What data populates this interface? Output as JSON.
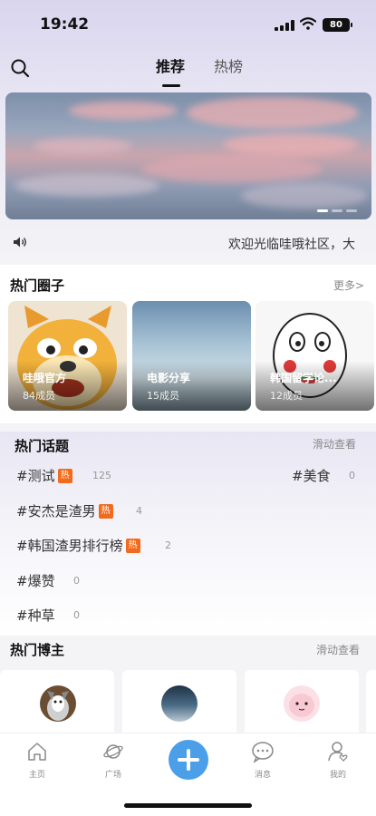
{
  "status": {
    "time": "19:42",
    "battery": "80"
  },
  "header": {
    "tabs": [
      {
        "label": "推荐",
        "active": true
      },
      {
        "label": "热榜",
        "active": false
      }
    ]
  },
  "notice": {
    "text": "欢迎光临哇哦社区，大"
  },
  "circles": {
    "title": "热门圈子",
    "more": "更多>",
    "items": [
      {
        "name": "哇哦官方",
        "members": "84成员"
      },
      {
        "name": "电影分享",
        "members": "15成员"
      },
      {
        "name": "韩国留学论...",
        "members": "12成员"
      }
    ]
  },
  "topics": {
    "title": "热门话题",
    "more": "滑动查看",
    "items": [
      {
        "label": "#测试",
        "hot": "热",
        "count": "125"
      },
      {
        "label": "#美食",
        "count": "0"
      },
      {
        "label": "#安杰是渣男",
        "hot": "热",
        "count": "4"
      },
      {
        "label": "#韩国渣男排行榜",
        "hot": "热",
        "count": "2"
      },
      {
        "label": "#爆赞",
        "count": "0"
      },
      {
        "label": "#种草",
        "count": "0"
      }
    ]
  },
  "bloggers": {
    "title": "热门博主",
    "more": "滑动查看"
  },
  "tabbar": {
    "items": [
      {
        "label": "主页",
        "icon": "home-icon"
      },
      {
        "label": "广场",
        "icon": "planet-icon"
      },
      {
        "label": "",
        "icon": "plus-icon"
      },
      {
        "label": "消息",
        "icon": "chat-icon"
      },
      {
        "label": "我的",
        "icon": "profile-icon"
      }
    ]
  },
  "colors": {
    "accent": "#4a9fe8",
    "hot": "#f26a1b",
    "header_bg": "#d9d5ee"
  }
}
